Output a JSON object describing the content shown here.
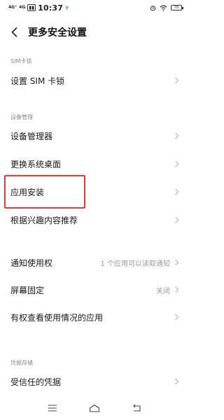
{
  "status": {
    "signal1": "4G⁺",
    "signal2": "4G",
    "time": "10:37",
    "battery": "78"
  },
  "header": {
    "title": "更多安全设置"
  },
  "sections": {
    "sim_lock": {
      "label": "SIM卡锁",
      "items": [
        {
          "label": "设置 SIM 卡锁"
        }
      ]
    },
    "device_mgmt": {
      "label": "设备管理",
      "items": [
        {
          "label": "设备管理器"
        },
        {
          "label": "更换系统桌面"
        },
        {
          "label": "应用安装"
        },
        {
          "label": "根据兴趣内容推荐"
        }
      ]
    },
    "misc": {
      "items": [
        {
          "label": "通知使用权",
          "value": "1 个应用可以读取通知"
        },
        {
          "label": "屏幕固定",
          "value": "关闭"
        },
        {
          "label": "有权查看使用情况的应用"
        }
      ]
    },
    "credential": {
      "label": "凭据存储",
      "items": [
        {
          "label": "受信任的凭据"
        }
      ]
    }
  },
  "colors": {
    "highlight": "#e53935",
    "secondary_text": "#9a9a9a"
  }
}
